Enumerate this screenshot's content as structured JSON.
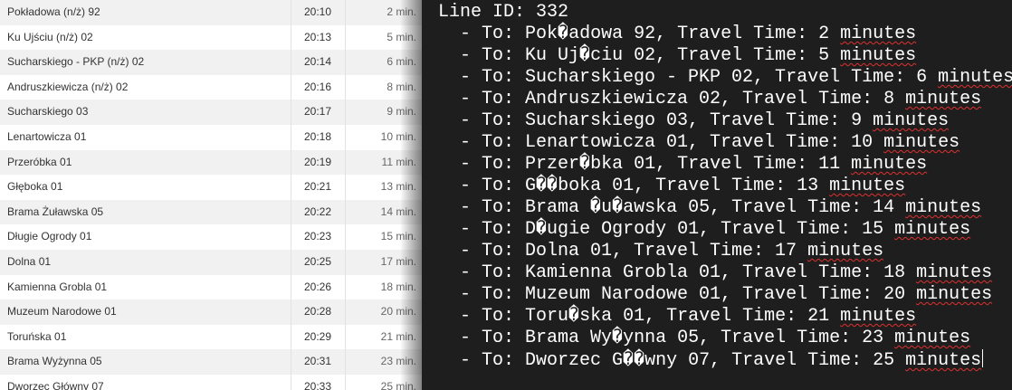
{
  "timetable": {
    "rows": [
      {
        "stop": "Pokładowa (n/ż) 92",
        "time": "20:10",
        "duration": "2 min."
      },
      {
        "stop": "Ku Ujściu (n/ż) 02",
        "time": "20:13",
        "duration": "5 min."
      },
      {
        "stop": "Sucharskiego - PKP (n/ż) 02",
        "time": "20:14",
        "duration": "6 min."
      },
      {
        "stop": "Andruszkiewicza (n/ż) 02",
        "time": "20:16",
        "duration": "8 min."
      },
      {
        "stop": "Sucharskiego 03",
        "time": "20:17",
        "duration": "9 min."
      },
      {
        "stop": "Lenartowicza 01",
        "time": "20:18",
        "duration": "10 min."
      },
      {
        "stop": "Przeróbka 01",
        "time": "20:19",
        "duration": "11 min."
      },
      {
        "stop": "Głęboka 01",
        "time": "20:21",
        "duration": "13 min."
      },
      {
        "stop": "Brama Żuławska 05",
        "time": "20:22",
        "duration": "14 min."
      },
      {
        "stop": "Długie Ogrody 01",
        "time": "20:23",
        "duration": "15 min."
      },
      {
        "stop": "Dolna 01",
        "time": "20:25",
        "duration": "17 min."
      },
      {
        "stop": "Kamienna Grobla 01",
        "time": "20:26",
        "duration": "18 min."
      },
      {
        "stop": "Muzeum Narodowe 01",
        "time": "20:28",
        "duration": "20 min."
      },
      {
        "stop": "Toruńska 01",
        "time": "20:29",
        "duration": "21 min."
      },
      {
        "stop": "Brama Wyżynna 05",
        "time": "20:31",
        "duration": "23 min."
      },
      {
        "stop": "Dworzec Główny 07",
        "time": "20:33",
        "duration": "25 min."
      }
    ]
  },
  "console": {
    "header": "Line ID: 332",
    "lines": [
      {
        "prefix": "  - To: Pok�adowa 92, Travel Time: 2 ",
        "word": "minutes"
      },
      {
        "prefix": "  - To: Ku Uj�ciu 02, Travel Time: 5 ",
        "word": "minutes"
      },
      {
        "prefix": "  - To: Sucharskiego - PKP 02, Travel Time: 6 ",
        "word": "minutes"
      },
      {
        "prefix": "  - To: Andruszkiewicza 02, Travel Time: 8 ",
        "word": "minutes"
      },
      {
        "prefix": "  - To: Sucharskiego 03, Travel Time: 9 ",
        "word": "minutes"
      },
      {
        "prefix": "  - To: Lenartowicza 01, Travel Time: 10 ",
        "word": "minutes"
      },
      {
        "prefix": "  - To: Przer�bka 01, Travel Time: 11 ",
        "word": "minutes"
      },
      {
        "prefix": "  - To: G��boka 01, Travel Time: 13 ",
        "word": "minutes"
      },
      {
        "prefix": "  - To: Brama �u�awska 05, Travel Time: 14 ",
        "word": "minutes"
      },
      {
        "prefix": "  - To: D�ugie Ogrody 01, Travel Time: 15 ",
        "word": "minutes"
      },
      {
        "prefix": "  - To: Dolna 01, Travel Time: 17 ",
        "word": "minutes"
      },
      {
        "prefix": "  - To: Kamienna Grobla 01, Travel Time: 18 ",
        "word": "minutes"
      },
      {
        "prefix": "  - To: Muzeum Narodowe 01, Travel Time: 20 ",
        "word": "minutes"
      },
      {
        "prefix": "  - To: Toru�ska 01, Travel Time: 21 ",
        "word": "minutes"
      },
      {
        "prefix": "  - To: Brama Wy�ynna 05, Travel Time: 23 ",
        "word": "minutes"
      },
      {
        "prefix": "  - To: Dworzec G��wny 07, Travel Time: 25 ",
        "word": "minutes"
      }
    ]
  },
  "colors": {
    "console_bg": "#1e1e1e",
    "console_text": "#ffffff",
    "spell_underline": "#e03030",
    "row_alt": "#f1f1f1"
  }
}
